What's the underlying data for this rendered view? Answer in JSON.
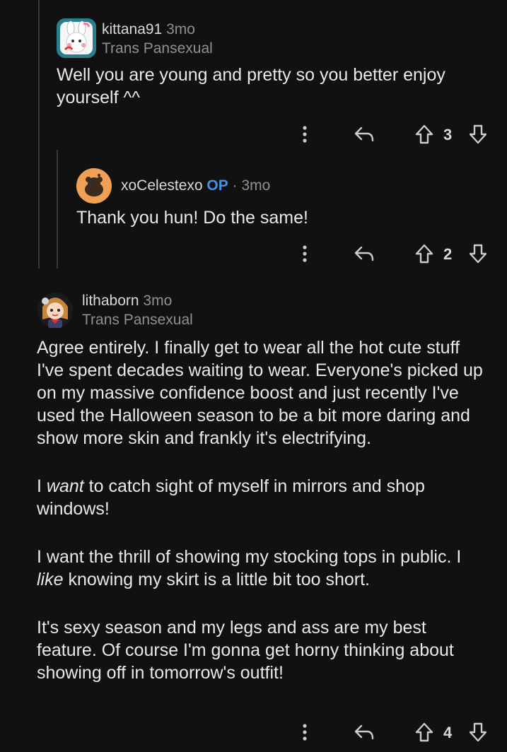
{
  "comments": [
    {
      "username": "kittana91",
      "age": "3mo",
      "flair": "Trans Pansexual",
      "body": [
        "Well you are young and pretty so you better enjoy yourself ^^"
      ],
      "score": "3"
    },
    {
      "username": "xoCelestexo",
      "op_label": "OP",
      "separator": "·",
      "age": "3mo",
      "body": [
        "Thank you hun! Do the same!"
      ],
      "score": "2"
    },
    {
      "username": "lithaborn",
      "age": "3mo",
      "flair": "Trans Pansexual",
      "body": [
        "Agree entirely. I finally get to wear all the hot cute stuff I've spent decades waiting to wear. Everyone's picked up on my massive confidence boost and just recently I've used the Halloween season to be a bit more daring and show more skin and frankly it's electrifying.",
        {
          "pre": "I ",
          "em": "want",
          "post": " to catch sight of myself in mirrors and shop windows!"
        },
        {
          "pre": "I want the thrill of showing my stocking tops in public. I ",
          "em": "like",
          "post": " knowing my skirt is a little bit too short."
        },
        "It's sexy season and my legs and ass are my best feature. Of course I'm gonna get horny thinking about showing off in tomorrow's outfit!"
      ],
      "score": "4"
    }
  ],
  "icons": {
    "more": "more-options-icon",
    "reply": "reply-icon",
    "upvote": "upvote-icon",
    "downvote": "downvote-icon"
  }
}
